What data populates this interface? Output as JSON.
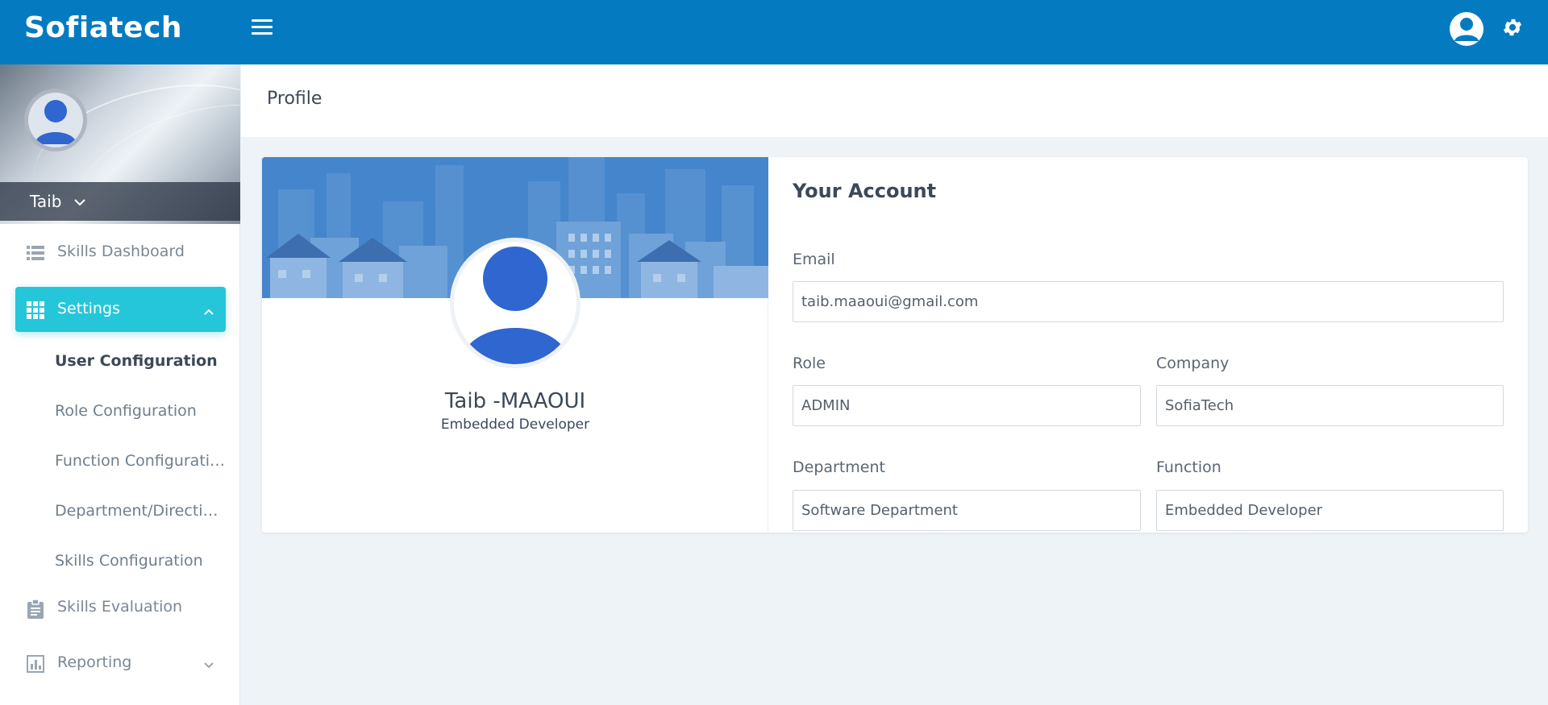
{
  "header": {
    "brand": "Sofiatech"
  },
  "sidebar": {
    "user_name": "Taib",
    "items": [
      {
        "label": "Skills Dashboard",
        "icon": "list-icon"
      },
      {
        "label": "Settings",
        "icon": "grid-icon",
        "active": true
      },
      {
        "label": "Skills Evaluation",
        "icon": "clipboard-icon"
      },
      {
        "label": "Reporting",
        "icon": "bar-chart-icon"
      }
    ],
    "settings_sub": [
      "User Configuration",
      "Role Configuration",
      "Function Configurati…",
      "Department/Directi…",
      "Skills Configuration"
    ]
  },
  "page": {
    "title": "Profile"
  },
  "profile": {
    "name": "Taib -MAAOUI",
    "job": "Embedded Developer"
  },
  "account": {
    "title": "Your Account",
    "email_label": "Email",
    "email": "taib.maaoui@gmail.com",
    "role_label": "Role",
    "role": "ADMIN",
    "company_label": "Company",
    "company": "SofiaTech",
    "department_label": "Department",
    "department": "Software Department",
    "function_label": "Function",
    "function": "Embedded Developer"
  },
  "colors": {
    "topbar": "#047bc1",
    "active": "#26c6da",
    "avatar_blue": "#2f66cf"
  }
}
